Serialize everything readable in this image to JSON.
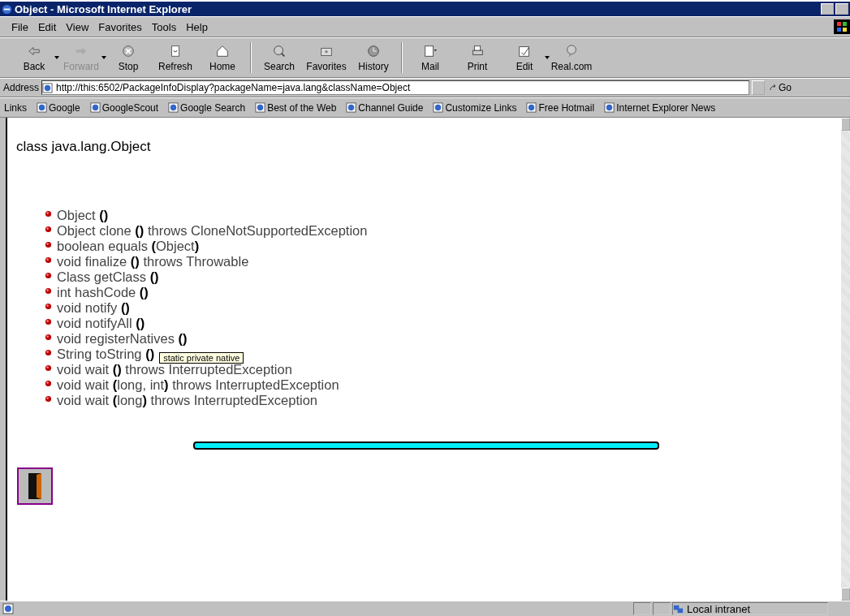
{
  "window": {
    "title": "Object - Microsoft Internet Explorer"
  },
  "menu": [
    "File",
    "Edit",
    "View",
    "Favorites",
    "Tools",
    "Help"
  ],
  "toolbar": [
    {
      "label": "Back",
      "kind": "back",
      "disabled": false,
      "dropdown": true
    },
    {
      "label": "Forward",
      "kind": "forward",
      "disabled": true,
      "dropdown": true
    },
    {
      "label": "Stop",
      "kind": "stop",
      "disabled": false,
      "dropdown": false
    },
    {
      "label": "Refresh",
      "kind": "refresh",
      "disabled": false,
      "dropdown": false
    },
    {
      "label": "Home",
      "kind": "home",
      "disabled": false,
      "dropdown": false
    },
    {
      "label": "Search",
      "kind": "search",
      "disabled": false,
      "dropdown": false
    },
    {
      "label": "Favorites",
      "kind": "favorites",
      "disabled": false,
      "dropdown": false
    },
    {
      "label": "History",
      "kind": "history",
      "disabled": false,
      "dropdown": false
    },
    {
      "label": "Mail",
      "kind": "mail",
      "disabled": false,
      "dropdown": false
    },
    {
      "label": "Print",
      "kind": "print",
      "disabled": false,
      "dropdown": false
    },
    {
      "label": "Edit",
      "kind": "edit",
      "disabled": false,
      "dropdown": true
    },
    {
      "label": "Real.com",
      "kind": "real",
      "disabled": false,
      "dropdown": false
    }
  ],
  "address": {
    "label": "Address",
    "url": "http://this:6502/PackageInfoDisplay?packageName=java.lang&className=Object",
    "go": "Go"
  },
  "links": {
    "label": "Links",
    "items": [
      "Google",
      "GoogleScout",
      "Google Search",
      "Best of the Web",
      "Channel Guide",
      "Customize Links",
      "Free Hotmail",
      "Internet Explorer News"
    ]
  },
  "page": {
    "heading": "class java.lang.Object",
    "methods": [
      {
        "text": "Object **()**"
      },
      {
        "text": "Object clone **()** throws CloneNotSupportedException"
      },
      {
        "text": "boolean equals **(**Object**)**"
      },
      {
        "text": "void finalize **()** throws Throwable"
      },
      {
        "text": "Class getClass **()**"
      },
      {
        "text": "int hashCode **()**"
      },
      {
        "text": "void notify **()**"
      },
      {
        "text": "void notifyAll **()**"
      },
      {
        "text": "void registerNatives **()**"
      },
      {
        "text": "String toString **()**",
        "tooltip": "static private native"
      },
      {
        "text": "void wait **()** throws InterruptedException"
      },
      {
        "text": "void wait **(**long, int**)** throws InterruptedException"
      },
      {
        "text": "void wait **(**long**)** throws InterruptedException"
      }
    ]
  },
  "status_bar": {
    "zone": "Local intranet"
  }
}
